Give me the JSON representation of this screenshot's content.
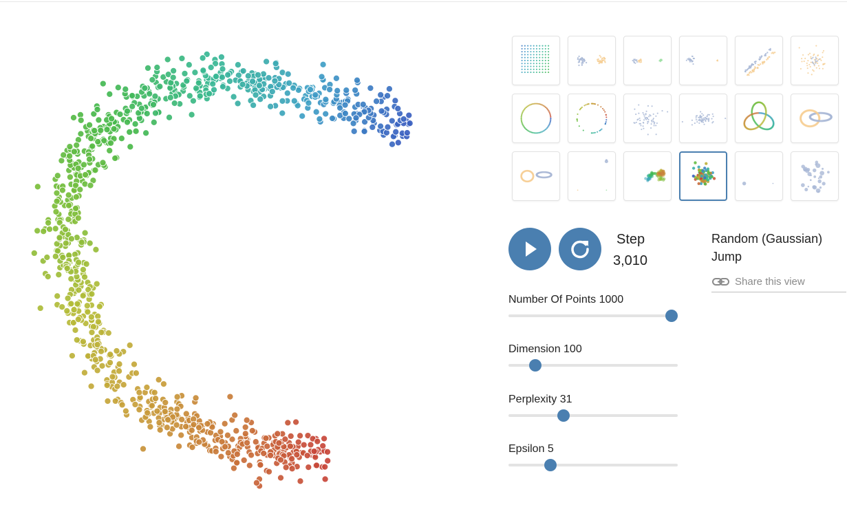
{
  "colors": {
    "accent": "#4a7fb0",
    "spectrum": [
      "#3b5fc0",
      "#3fa0c6",
      "#38b893",
      "#45b94c",
      "#7cbe3a",
      "#b5bc38",
      "#c8a23a",
      "#c97a3a",
      "#c8443a"
    ]
  },
  "thumbnails": [
    {
      "id": "grid",
      "selected": false
    },
    {
      "id": "two-clusters",
      "selected": false
    },
    {
      "id": "three-clusters",
      "selected": false
    },
    {
      "id": "two-different-clusters",
      "selected": false
    },
    {
      "id": "two-long-linear-clusters",
      "selected": false
    },
    {
      "id": "cluster-in-cluster",
      "selected": false
    },
    {
      "id": "circle-evenly-spaced",
      "selected": false
    },
    {
      "id": "circle-randomly-spaced",
      "selected": false
    },
    {
      "id": "gaussian-cloud",
      "selected": false
    },
    {
      "id": "ellipsoidal-gaussian-cloud",
      "selected": false
    },
    {
      "id": "trefoil-knot",
      "selected": false
    },
    {
      "id": "linked-rings",
      "selected": false
    },
    {
      "id": "unlinked-rings",
      "selected": false
    },
    {
      "id": "orthogonal-steps",
      "selected": false
    },
    {
      "id": "random-walk",
      "selected": false
    },
    {
      "id": "random-jump",
      "selected": true
    },
    {
      "id": "equally-spaced",
      "selected": false
    },
    {
      "id": "uniform-points",
      "selected": false
    }
  ],
  "controls": {
    "play_icon": "play-icon",
    "restart_icon": "restart-icon",
    "step_label": "Step",
    "step_value": "3,010"
  },
  "dataset": {
    "name_line1": "Random (Gaussian)",
    "name_line2": "Jump"
  },
  "share": {
    "label": "Share this view",
    "icon": "link-icon"
  },
  "params": [
    {
      "label": "Number Of Points 1000",
      "fraction": 1.0
    },
    {
      "label": "Dimension 100",
      "fraction": 0.13
    },
    {
      "label": "Perplexity 31",
      "fraction": 0.31
    },
    {
      "label": "Epsilon 5",
      "fraction": 0.23
    }
  ]
}
